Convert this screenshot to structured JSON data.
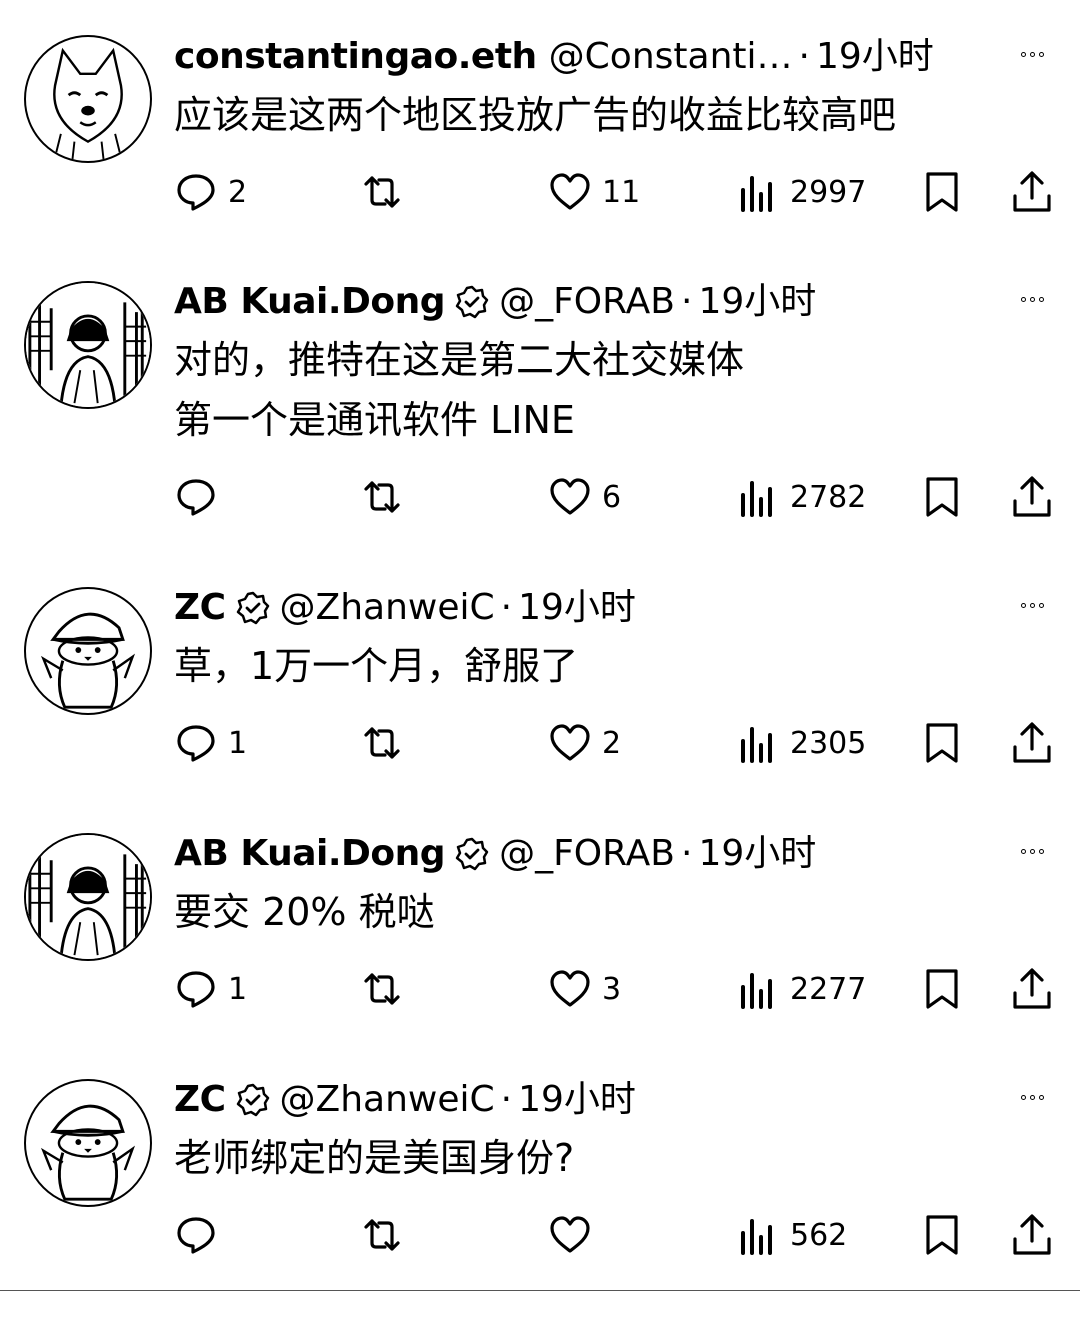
{
  "replies": [
    {
      "display_name": "constantingao.eth",
      "verified": false,
      "handle": "@Constanti…",
      "separator": "·",
      "time": "19小时",
      "lines": [
        "应该是这两个地区投放广告的收益比较高吧"
      ],
      "reply_count": "2",
      "like_count": "11",
      "view_count": "2997",
      "avatar": "shiba-dog-avatar"
    },
    {
      "display_name": "AB Kuai.Dong",
      "verified": true,
      "handle": "@_FORAB",
      "separator": "·",
      "time": "19小时",
      "lines": [
        "对的，推特在这是第二大社交媒体",
        "第一个是通讯软件 LINE"
      ],
      "reply_count": "",
      "like_count": "6",
      "view_count": "2782",
      "avatar": "person-city-avatar"
    },
    {
      "display_name": "ZC",
      "verified": true,
      "handle": "@ZhanweiC",
      "separator": "·",
      "time": "19小时",
      "lines": [
        "草，1万一个月，舒服了"
      ],
      "reply_count": "1",
      "like_count": "2",
      "view_count": "2305",
      "avatar": "penguin-cap-avatar"
    },
    {
      "display_name": "AB Kuai.Dong",
      "verified": true,
      "handle": "@_FORAB",
      "separator": "·",
      "time": "19小时",
      "lines": [
        "要交 20% 税哒"
      ],
      "reply_count": "1",
      "like_count": "3",
      "view_count": "2277",
      "avatar": "person-city-avatar"
    },
    {
      "display_name": "ZC",
      "verified": true,
      "handle": "@ZhanweiC",
      "separator": "·",
      "time": "19小时",
      "lines": [
        "老师绑定的是美国身份?"
      ],
      "reply_count": "",
      "like_count": "",
      "view_count": "562",
      "avatar": "penguin-cap-avatar"
    }
  ],
  "colors": {
    "text": "#000000",
    "background": "#ffffff"
  }
}
